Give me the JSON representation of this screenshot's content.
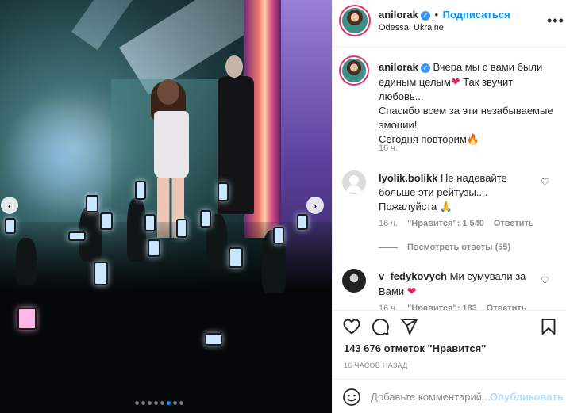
{
  "header": {
    "username": "anilorak",
    "separator": "•",
    "follow_label": "Подписаться",
    "location": "Odessa, Ukraine",
    "more_icon": "more-options-icon"
  },
  "caption": {
    "username": "anilorak",
    "lines": [
      "Вчера мы с вами были",
      "единым целым",
      "Так звучит",
      "любовь...",
      "Спасибо всем за эти незабываемые",
      "эмоции!",
      "Сегодня повторим"
    ],
    "emojis": [
      "heart",
      "fire"
    ],
    "time": "16 ч."
  },
  "comments": [
    {
      "username": "lyolik.bolikk",
      "text": "Не надевайте больше эти рейтузы.... Пожалуйста",
      "emoji": "pray",
      "time": "16 ч.",
      "likes": "\"Нравится\": 1 540",
      "reply": "Ответить",
      "view_replies": "Посмотреть ответы (55)"
    },
    {
      "username": "v_fedykovych",
      "text": "Ми сумували за Вами",
      "emoji": "heart",
      "time": "16 ч.",
      "likes": "\"Нравится\": 183",
      "reply": "Ответить"
    }
  ],
  "stats": {
    "likes": "143 676 отметок \"Нравится\"",
    "posted": "16 ЧАСОВ НАЗАД"
  },
  "composer": {
    "placeholder": "Добавьте комментарий...",
    "publish_label": "Опубликовать"
  },
  "carousel": {
    "slides": 8,
    "active": 6
  },
  "colors": {
    "accent": "#0095f6",
    "heart": "#e0245e",
    "muted": "#8e8e8e",
    "verified": "#3897f0"
  }
}
